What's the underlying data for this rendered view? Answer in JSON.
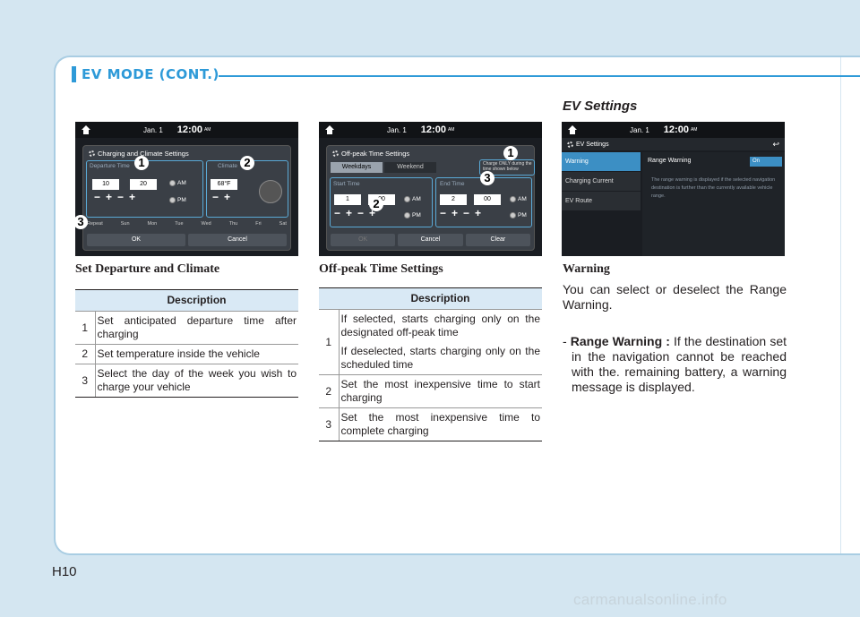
{
  "section_title": "EV MODE (CONT.)",
  "ev_settings_heading": "EV Settings",
  "screens": {
    "common": {
      "date": "Jan. 1",
      "time": "12:00",
      "ampm": "AM"
    },
    "s1": {
      "title": "Charging and Climate Settings",
      "departure_label": "Departure Time",
      "climate_label": "Climate",
      "hour": "10",
      "minute": "20",
      "am": "AM",
      "pm": "PM",
      "temp": "68°F",
      "repeat_label": "Repeat",
      "days": [
        "Sun",
        "Mon",
        "Tue",
        "Wed",
        "Thu",
        "Fri",
        "Sat"
      ],
      "ok": "OK",
      "cancel": "Cancel"
    },
    "s2": {
      "title": "Off-peak Time Settings",
      "tab_weekdays": "Weekdays",
      "tab_weekend": "Weekend",
      "checkbox_note": "Charge ONLY during the time shown below",
      "start_label": "Start Time",
      "end_label": "End Time",
      "start_hour": "1",
      "start_min": "00",
      "end_hour": "2",
      "end_min": "00",
      "am": "AM",
      "pm": "PM",
      "ok": "OK",
      "cancel": "Cancel",
      "clear": "Clear"
    },
    "s3": {
      "title": "EV Settings",
      "menu": [
        "Warning",
        "Charging Current",
        "EV Route"
      ],
      "range_warning": "Range Warning",
      "on": "On",
      "note": "The range warning is displayed if the selected navigation destination is further than the currently available vehicle range."
    }
  },
  "badges": {
    "b1": "1",
    "b2": "2",
    "b3": "3"
  },
  "captions": {
    "c1": "Set Departure and Climate",
    "c2": "Off-peak Time Settings"
  },
  "table1": {
    "header": "Description",
    "rows": [
      {
        "n": "1",
        "text": "Set anticipated departure time after charging"
      },
      {
        "n": "2",
        "text": "Set temperature inside the vehicle"
      },
      {
        "n": "3",
        "text": "Select the day of the week you wish to charge your vehicle"
      }
    ]
  },
  "table2": {
    "header": "Description",
    "rows": [
      {
        "n": "1",
        "text_a": "If selected, starts charging only on the designated off-peak time",
        "text_b": "If deselected, starts charging only on the scheduled time"
      },
      {
        "n": "2",
        "text": "Set the most inexpensive time to start charging"
      },
      {
        "n": "3",
        "text": "Set the most inexpensive time to complete charging"
      }
    ]
  },
  "warning": {
    "heading": "Warning",
    "para1": "You can select or deselect  the Range Warning.",
    "dash": "- ",
    "term": "Range Warning :",
    "para2": " If the destination set in the navigation cannot be reached with the. remaining battery, a warning message is displayed."
  },
  "page_number": "H10",
  "watermark": "carmanualsonline.info"
}
